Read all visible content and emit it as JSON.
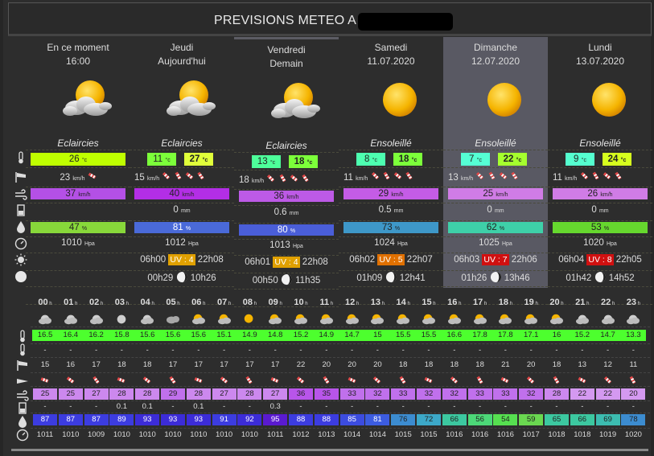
{
  "title": "PREVISIONS METEO A",
  "days": [
    {
      "name": "En ce moment",
      "date": "16:00",
      "desc": "Eclaircies",
      "icon": "sun-cloud-icon",
      "temp_single": "26",
      "wind_text": "23",
      "wind_unit": "km/h",
      "gust": "37",
      "gust_unit": "km/h",
      "rain": "",
      "hum": "47",
      "press": "1010",
      "press_unit": "Hpa"
    },
    {
      "name": "Jeudi",
      "date": "Aujourd'hui",
      "desc": "Eclaircies",
      "icon": "sun-cloud-icon",
      "tmin": "11",
      "tmax": "27",
      "wind_text": "15",
      "wind_unit": "km/h",
      "gust": "40",
      "gust_unit": "km/h",
      "rain": "0",
      "rain_unit": "mm",
      "hum": "81",
      "press": "1012",
      "press_unit": "Hpa",
      "sunrise": "06h00",
      "uv": "UV : 4",
      "sunset": "22h08",
      "moonrise": "00h29",
      "moonset": "10h26"
    },
    {
      "name": "Vendredi",
      "date": "Demain",
      "desc": "Eclaircies",
      "icon": "sun-cloud-icon",
      "tmin": "13",
      "tmax": "18",
      "wind_text": "18",
      "wind_unit": "km/h",
      "gust": "36",
      "gust_unit": "km/h",
      "rain": "0.6",
      "rain_unit": "mm",
      "hum": "80",
      "press": "1013",
      "press_unit": "Hpa",
      "sunrise": "06h01",
      "uv": "UV : 4",
      "sunset": "22h08",
      "moonrise": "00h50",
      "moonset": "11h35"
    },
    {
      "name": "Samedi",
      "date": "11.07.2020",
      "desc": "Ensoleillé",
      "icon": "sun-icon",
      "tmin": "8",
      "tmax": "18",
      "wind_text": "11",
      "wind_unit": "km/h",
      "gust": "29",
      "gust_unit": "km/h",
      "rain": "0.5",
      "rain_unit": "mm",
      "hum": "73",
      "press": "1024",
      "press_unit": "Hpa",
      "sunrise": "06h02",
      "uv": "UV : 5",
      "sunset": "22h07",
      "moonrise": "01h09",
      "moonset": "12h41"
    },
    {
      "name": "Dimanche",
      "date": "12.07.2020",
      "desc": "Ensoleillé",
      "icon": "sun-icon",
      "tmin": "7",
      "tmax": "22",
      "wind_text": "13",
      "wind_unit": "km/h",
      "gust": "25",
      "gust_unit": "km/h",
      "rain": "0",
      "rain_unit": "mm",
      "hum": "62",
      "press": "1025",
      "press_unit": "Hpa",
      "sunrise": "06h03",
      "uv": "UV : 7",
      "sunset": "22h06",
      "moonrise": "01h26",
      "moonset": "13h46"
    },
    {
      "name": "Lundi",
      "date": "13.07.2020",
      "desc": "Ensoleillé",
      "icon": "sun-icon",
      "tmin": "9",
      "tmax": "24",
      "wind_text": "11",
      "wind_unit": "km/h",
      "gust": "26",
      "gust_unit": "km/h",
      "rain": "0",
      "rain_unit": "mm",
      "hum": "53",
      "press": "1020",
      "press_unit": "Hpa",
      "sunrise": "06h04",
      "uv": "UV : 8",
      "sunset": "22h05",
      "moonrise": "01h42",
      "moonset": "14h52"
    }
  ],
  "units": {
    "temp": "°c",
    "hum": "%"
  },
  "colors": {
    "temp_now": "#bfff00",
    "tmin": [
      "#7cff3a",
      "#4dff9a",
      "#4dffb0",
      "#55ffd4",
      "#55ffcf"
    ],
    "tmax": [
      "#e0ff3a",
      "#7cff3a",
      "#7cff3a",
      "#a5ff2e",
      "#d6ff1e"
    ],
    "gust": [
      "#b450e6",
      "#b32ee6",
      "#bd5ae6",
      "#c45ce6",
      "#d07ce6",
      "#d07ce6"
    ],
    "hum": [
      "#88d83a",
      "#4a6ad8",
      "#4a5ed8",
      "#3e98c8",
      "#3ed0a8",
      "#66d82e"
    ],
    "uv": [
      "#e0a000",
      "#e0a000",
      "#e07000",
      "#d01010",
      "#d01010"
    ],
    "page_bg": "#2d2d2d",
    "highlight_col": "#595963"
  },
  "hours": {
    "labels": [
      "00",
      "01",
      "02",
      "03",
      "04",
      "05",
      "06",
      "07",
      "08",
      "09",
      "10",
      "11",
      "12",
      "13",
      "14",
      "15",
      "16",
      "17",
      "18",
      "19",
      "20",
      "21",
      "22",
      "23"
    ],
    "unit": "h",
    "icons": [
      "moon-cloud-icon",
      "moon-cloud-icon",
      "moon-cloud-icon",
      "moon-icon",
      "moon-cloud-icon",
      "cloud-icon",
      "sun-cloud-icon",
      "sun-cloud-icon",
      "sun-icon",
      "sun-cloud-icon",
      "sun-cloud-icon",
      "sun-cloud-icon",
      "sun-cloud-icon",
      "sun-cloud-icon",
      "sun-cloud-icon",
      "sun-cloud-icon",
      "sun-cloud-icon",
      "sun-cloud-icon",
      "sun-cloud-icon",
      "sun-cloud-icon",
      "sun-cloud-icon",
      "moon-cloud-icon",
      "moon-cloud-icon",
      "moon-cloud-icon"
    ],
    "temp": [
      "16.5",
      "16.4",
      "16.2",
      "15.8",
      "15.6",
      "15.6",
      "15.6",
      "15.1",
      "14.9",
      "14.8",
      "15.2",
      "14.9",
      "14.7",
      "15",
      "15.5",
      "15.5",
      "16.6",
      "17.8",
      "17.8",
      "17.1",
      "16",
      "15.2",
      "14.7",
      "13.3"
    ],
    "dew": [
      "-",
      "-",
      "-",
      "-",
      "-",
      "-",
      "-",
      "-",
      "-",
      "-",
      "-",
      "-",
      "-",
      "-",
      "-",
      "-",
      "-",
      "-",
      "-",
      "-",
      "-",
      "-",
      "-",
      "-"
    ],
    "wind": [
      "15",
      "16",
      "17",
      "18",
      "18",
      "17",
      "17",
      "17",
      "17",
      "17",
      "22",
      "20",
      "20",
      "20",
      "18",
      "18",
      "18",
      "18",
      "21",
      "20",
      "18",
      "13",
      "12",
      "11"
    ],
    "gust": [
      "25",
      "25",
      "27",
      "28",
      "28",
      "29",
      "28",
      "27",
      "28",
      "27",
      "36",
      "35",
      "33",
      "32",
      "33",
      "32",
      "32",
      "33",
      "33",
      "32",
      "28",
      "22",
      "22",
      "20"
    ],
    "gust_colors": [
      "#cc88ee",
      "#cc88ee",
      "#cc88ee",
      "#cc88ee",
      "#cc88ee",
      "#c070ec",
      "#cc88ee",
      "#cc88ee",
      "#cc88ee",
      "#cc88ee",
      "#b855ea",
      "#b855ea",
      "#c070ec",
      "#c070ec",
      "#c070ec",
      "#c070ec",
      "#c070ec",
      "#c070ec",
      "#c070ec",
      "#c070ec",
      "#cc88ee",
      "#d499f0",
      "#d499f0",
      "#d499f0"
    ],
    "rain": [
      "-",
      "-",
      "-",
      "0.1",
      "0.1",
      "-",
      "0.1",
      "-",
      "-",
      "0.3",
      "-",
      "-",
      "-",
      "-",
      "-",
      "-",
      "-",
      "-",
      "-",
      "-",
      "-",
      "-",
      "-",
      "-"
    ],
    "hum": [
      "87",
      "87",
      "87",
      "89",
      "93",
      "93",
      "93",
      "91",
      "92",
      "95",
      "88",
      "88",
      "85",
      "81",
      "76",
      "72",
      "66",
      "56",
      "54",
      "59",
      "65",
      "66",
      "69",
      "78"
    ],
    "hum_colors": [
      "#3c3ce0",
      "#3c3ce0",
      "#3c3ce0",
      "#3c3ce0",
      "#3c2cd8",
      "#3c2cd8",
      "#3c2cd8",
      "#3c3ce0",
      "#3c2cd8",
      "#5a1ad0",
      "#3c3ce0",
      "#3c3ce0",
      "#3c4ce0",
      "#3c5ce0",
      "#3c8cd0",
      "#3ca8c8",
      "#3cc8a0",
      "#4cd878",
      "#56e050",
      "#6ad850",
      "#3cc8a0",
      "#3cc8a0",
      "#3cbcb0",
      "#3c8cd0"
    ],
    "press": [
      "1011",
      "1010",
      "1009",
      "1010",
      "1010",
      "1010",
      "1010",
      "1010",
      "1010",
      "1011",
      "1012",
      "1013",
      "1014",
      "1014",
      "1015",
      "1015",
      "1016",
      "1016",
      "1016",
      "1017",
      "1018",
      "1018",
      "1019",
      "1020"
    ]
  }
}
